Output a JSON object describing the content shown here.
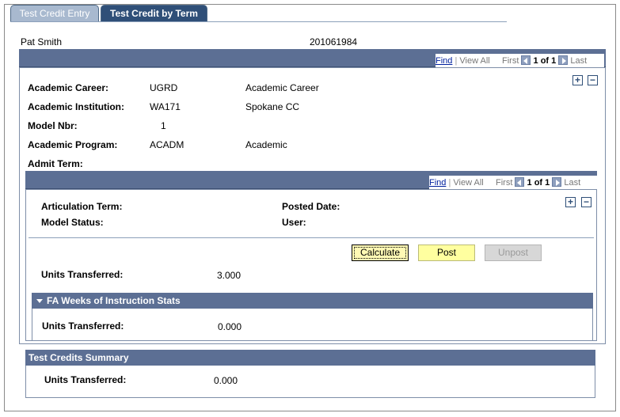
{
  "tabs": [
    {
      "label": "Test Credit Entry",
      "active": false
    },
    {
      "label": "Test Credit by Term",
      "active": true
    }
  ],
  "person": {
    "name": "Pat Smith",
    "id": "201061984"
  },
  "nav": {
    "find": "Find",
    "view_all": "View All",
    "first": "First",
    "count": "1 of 1",
    "last": "Last"
  },
  "fields": {
    "career_label": "Academic Career:",
    "career_code": "UGRD",
    "career_desc": "Academic Career",
    "institution_label": "Academic Institution:",
    "institution_code": "WA171",
    "institution_desc": "Spokane CC",
    "model_label": "Model Nbr:",
    "model_value": "1",
    "program_label": "Academic Program:",
    "program_code": "ACADM",
    "program_desc": "Academic",
    "admit_label": "Admit Term:"
  },
  "inner": {
    "articulation_label": "Articulation Term:",
    "posted_label": "Posted Date:",
    "status_label": "Model Status:",
    "user_label": "User:",
    "calculate": "Calculate",
    "post": "Post",
    "unpost": "Unpost",
    "units_label": "Units Transferred:",
    "units_value": "3.000"
  },
  "fa_section": {
    "title": "FA Weeks of Instruction Stats",
    "units_label": "Units Transferred:",
    "units_value": "0.000"
  },
  "summary": {
    "title": "Test Credits Summary",
    "units_label": "Units Transferred:",
    "units_value": "0.000"
  },
  "icons": {
    "add": "+",
    "remove": "−"
  },
  "colors": {
    "header_bar": "#5c6f94",
    "tab_active": "#2f4f78",
    "tab_inactive": "#a8b9cf",
    "post_button": "#ffff9f"
  }
}
